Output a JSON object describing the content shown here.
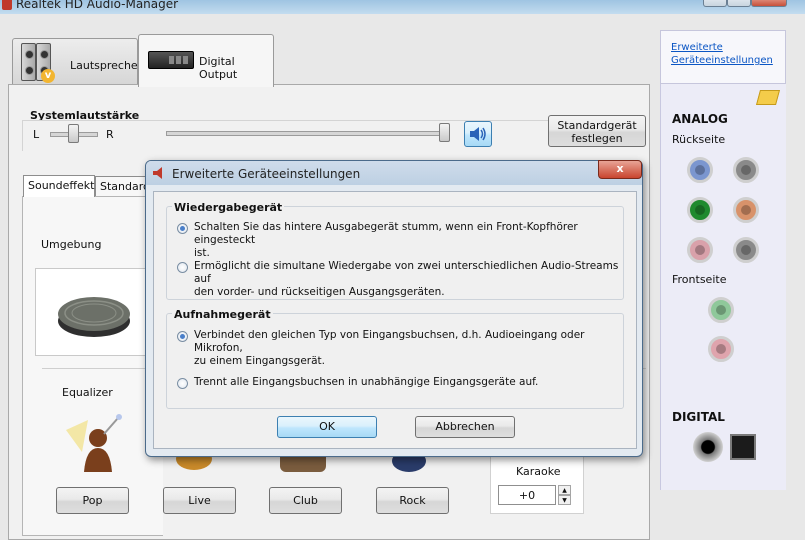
{
  "window": {
    "title": "Realtek HD Audio-Manager"
  },
  "device_tabs": [
    {
      "label": "Lautsprecher"
    },
    {
      "label": "Digital Output"
    }
  ],
  "volume": {
    "label": "Systemlautstärke",
    "balance_left": "L",
    "balance_right": "R",
    "balance": 0.5,
    "level": 1.0
  },
  "default_device_button": {
    "line1": "Standardgerät",
    "line2": "festlegen"
  },
  "sub_tabs": [
    {
      "label": "Soundeffekt"
    },
    {
      "label": "Standard"
    }
  ],
  "environment": {
    "label": "Umgebung"
  },
  "equalizer": {
    "label": "Equalizer"
  },
  "presets": [
    {
      "label": "Pop"
    },
    {
      "label": "Live"
    },
    {
      "label": "Club"
    },
    {
      "label": "Rock"
    }
  ],
  "karaoke": {
    "label": "Karaoke",
    "value": "+0"
  },
  "sidebar": {
    "link": "Erweiterte Geräteeinstellungen",
    "analog_heading": "ANALOG",
    "rear_label": "Rückseite",
    "front_label": "Frontseite",
    "digital_heading": "DIGITAL",
    "rear_jacks": [
      {
        "color": "#7b96cf"
      },
      {
        "color": "#8a8a8a"
      },
      {
        "color": "#1f8a2e"
      },
      {
        "color": "#d8926a"
      },
      {
        "color": "#d9a1aa"
      },
      {
        "color": "#8a8a8a"
      }
    ],
    "front_jacks": [
      {
        "color": "#8fc89a"
      },
      {
        "color": "#dfa4ad"
      }
    ]
  },
  "dialog": {
    "title": "Erweiterte Geräteeinstellungen",
    "close_glyph": "x",
    "playback": {
      "heading": "Wiedergabegerät",
      "options": [
        {
          "line1": "Schalten Sie das hintere Ausgabegerät stumm, wenn ein Front-Kopfhörer eingesteckt",
          "line2": "ist.",
          "selected": true
        },
        {
          "line1": "Ermöglicht die simultane Wiedergabe von zwei unterschiedlichen Audio-Streams auf",
          "line2": "den vorder- und rückseitigen Ausgangsgeräten.",
          "selected": false
        }
      ]
    },
    "recording": {
      "heading": "Aufnahmegerät",
      "options": [
        {
          "line1": "Verbindet den gleichen Typ von Eingangsbuchsen, d.h. Audioeingang oder Mikrofon,",
          "line2": "zu einem Eingangsgerät.",
          "selected": true
        },
        {
          "line1": "Trennt alle Eingangsbuchsen in unabhängige Eingangsgeräte auf.",
          "line2": "",
          "selected": false
        }
      ]
    },
    "ok_label": "OK",
    "cancel_label": "Abbrechen"
  }
}
